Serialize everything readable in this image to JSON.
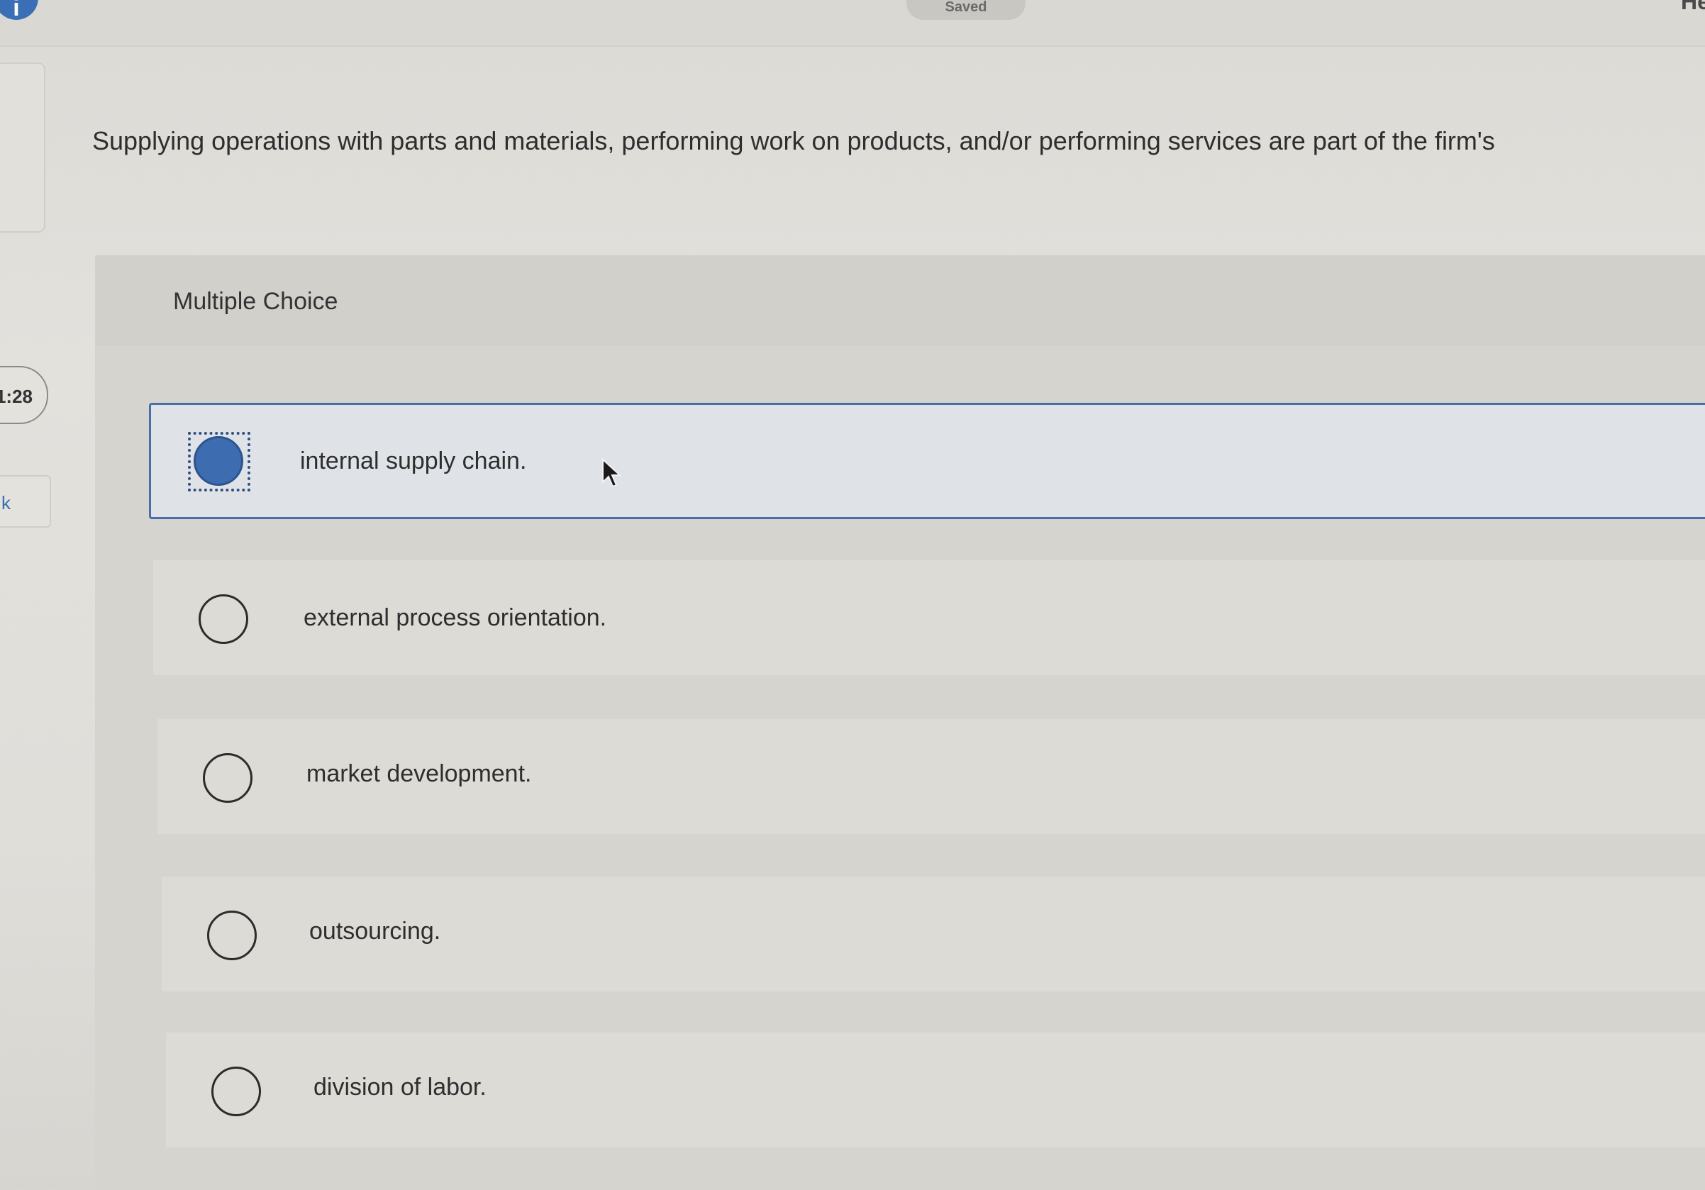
{
  "header": {
    "info_icon": "info-icon",
    "saved_label": "Saved",
    "help_label": "He"
  },
  "sidebar": {
    "timer": "1:28",
    "tab_glyph": "k"
  },
  "question": {
    "text": "Supplying operations with parts and materials, performing work on products, and/or performing services are part of the firm's"
  },
  "answer_panel": {
    "type_label": "Multiple Choice",
    "options": [
      {
        "label": "internal supply chain.",
        "selected": true
      },
      {
        "label": "external process orientation.",
        "selected": false
      },
      {
        "label": "market development.",
        "selected": false
      },
      {
        "label": "outsourcing.",
        "selected": false
      },
      {
        "label": "division of labor.",
        "selected": false
      }
    ]
  },
  "colors": {
    "accent": "#3d6cb0",
    "selected_border": "#4a6fa8",
    "background": "#e0ded9"
  }
}
